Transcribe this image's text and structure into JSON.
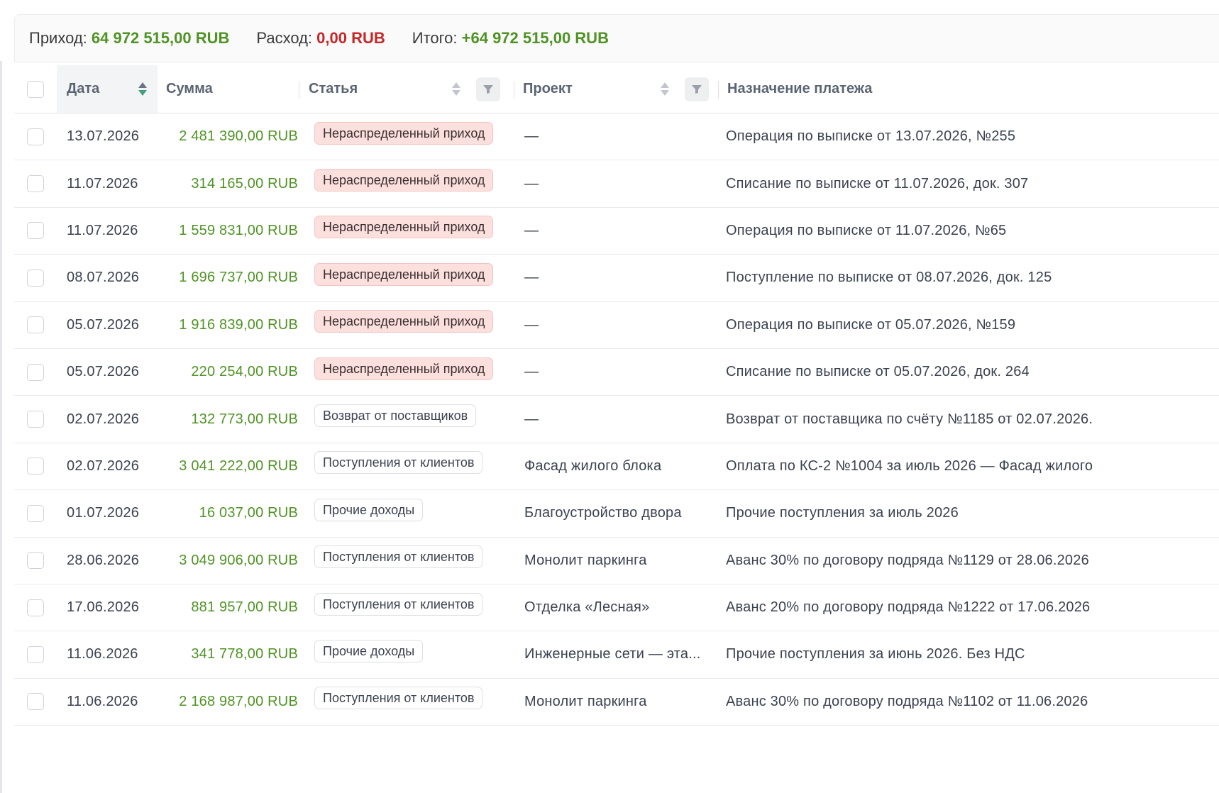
{
  "summary": {
    "income_label": "Приход:",
    "income_value": "64 972 515,00 RUB",
    "expense_label": "Расход:",
    "expense_value": "0,00 RUB",
    "total_label": "Итого:",
    "total_value": "+64 972 515,00 RUB"
  },
  "colors": {
    "positive": "#4f9324",
    "negative": "#c62828",
    "tag_unassigned_bg": "#fbe0de"
  },
  "table": {
    "headers": {
      "date": "Дата",
      "sum": "Сумма",
      "article": "Статья",
      "project": "Проект",
      "purpose": "Назначение платежа"
    },
    "rows": [
      {
        "date": "13.07.2026",
        "sum": "2 481 390,00 RUB",
        "article": "Нераспределенный приход",
        "article_style": "red",
        "project": "—",
        "purpose": "Операция по выписке от 13.07.2026, №255"
      },
      {
        "date": "11.07.2026",
        "sum": "314 165,00 RUB",
        "article": "Нераспределенный приход",
        "article_style": "red",
        "project": "—",
        "purpose": "Списание по выписке от 11.07.2026, док. 307"
      },
      {
        "date": "11.07.2026",
        "sum": "1 559 831,00 RUB",
        "article": "Нераспределенный приход",
        "article_style": "red",
        "project": "—",
        "purpose": "Операция по выписке от 11.07.2026, №65"
      },
      {
        "date": "08.07.2026",
        "sum": "1 696 737,00 RUB",
        "article": "Нераспределенный приход",
        "article_style": "red",
        "project": "—",
        "purpose": "Поступление по выписке от 08.07.2026, док. 125"
      },
      {
        "date": "05.07.2026",
        "sum": "1 916 839,00 RUB",
        "article": "Нераспределенный приход",
        "article_style": "red",
        "project": "—",
        "purpose": "Операция по выписке от 05.07.2026, №159"
      },
      {
        "date": "05.07.2026",
        "sum": "220 254,00 RUB",
        "article": "Нераспределенный приход",
        "article_style": "red",
        "project": "—",
        "purpose": "Списание по выписке от 05.07.2026, док. 264"
      },
      {
        "date": "02.07.2026",
        "sum": "132 773,00 RUB",
        "article": "Возврат от поставщиков",
        "article_style": "plain",
        "project": "—",
        "purpose": "Возврат от поставщика по счёту №1185 от 02.07.2026."
      },
      {
        "date": "02.07.2026",
        "sum": "3 041 222,00 RUB",
        "article": "Поступления от клиентов",
        "article_style": "plain",
        "project": "Фасад жилого блока",
        "purpose": "Оплата по КС-2 №1004 за июль 2026 — Фасад жилого"
      },
      {
        "date": "01.07.2026",
        "sum": "16 037,00 RUB",
        "article": "Прочие доходы",
        "article_style": "plain",
        "project": "Благоустройство двора",
        "purpose": "Прочие поступления за июль 2026"
      },
      {
        "date": "28.06.2026",
        "sum": "3 049 906,00 RUB",
        "article": "Поступления от клиентов",
        "article_style": "plain",
        "project": "Монолит паркинга",
        "purpose": "Аванс 30% по договору подряда №1129 от 28.06.2026"
      },
      {
        "date": "17.06.2026",
        "sum": "881 957,00 RUB",
        "article": "Поступления от клиентов",
        "article_style": "plain",
        "project": "Отделка «Лесная»",
        "purpose": "Аванс 20% по договору подряда №1222 от 17.06.2026"
      },
      {
        "date": "11.06.2026",
        "sum": "341 778,00 RUB",
        "article": "Прочие доходы",
        "article_style": "plain",
        "project": "Инженерные сети — эта...",
        "purpose": "Прочие поступления за июнь 2026. Без НДС"
      },
      {
        "date": "11.06.2026",
        "sum": "2 168 987,00 RUB",
        "article": "Поступления от клиентов",
        "article_style": "plain",
        "project": "Монолит паркинга",
        "purpose": "Аванс 30% по договору подряда №1102 от 11.06.2026"
      }
    ]
  }
}
